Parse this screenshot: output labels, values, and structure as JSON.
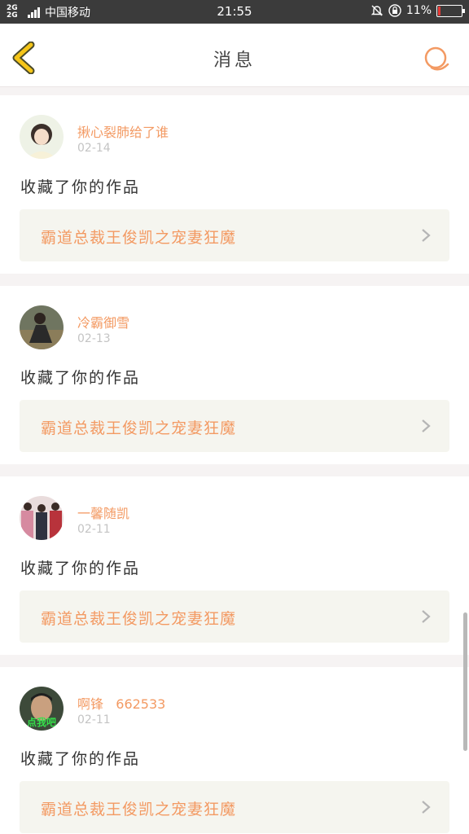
{
  "status_bar": {
    "network_type": "2G 2G",
    "carrier": "中国移动",
    "time": "21:55",
    "battery_percent": "11%",
    "battery_level": 0.11
  },
  "header": {
    "title": "消息"
  },
  "messages": [
    {
      "user_name": "揪心裂肺给了谁",
      "date": "02-14",
      "text": "收藏了你的作品",
      "work_title": "霸道总裁王俊凯之宠妻狂魔"
    },
    {
      "user_name": "冷霸御雪",
      "date": "02-13",
      "text": "收藏了你的作品",
      "work_title": "霸道总裁王俊凯之宠妻狂魔"
    },
    {
      "user_name": "一馨随凯",
      "date": "02-11",
      "text": "收藏了你的作品",
      "work_title": "霸道总裁王俊凯之宠妻狂魔"
    },
    {
      "user_name": "啊锋   662533",
      "date": "02-11",
      "text": "收藏了你的作品",
      "work_title": "霸道总裁王俊凯之宠妻狂魔",
      "avatar_caption": "点我吧"
    }
  ],
  "icons": {
    "back": "back-chevron-icon",
    "search": "search-icon",
    "chevron": "chevron-right-icon"
  },
  "colors": {
    "accent": "#f39a63",
    "back_icon": "#f5c518",
    "card_background": "#ffffff",
    "link_background": "#f5f5ef"
  }
}
